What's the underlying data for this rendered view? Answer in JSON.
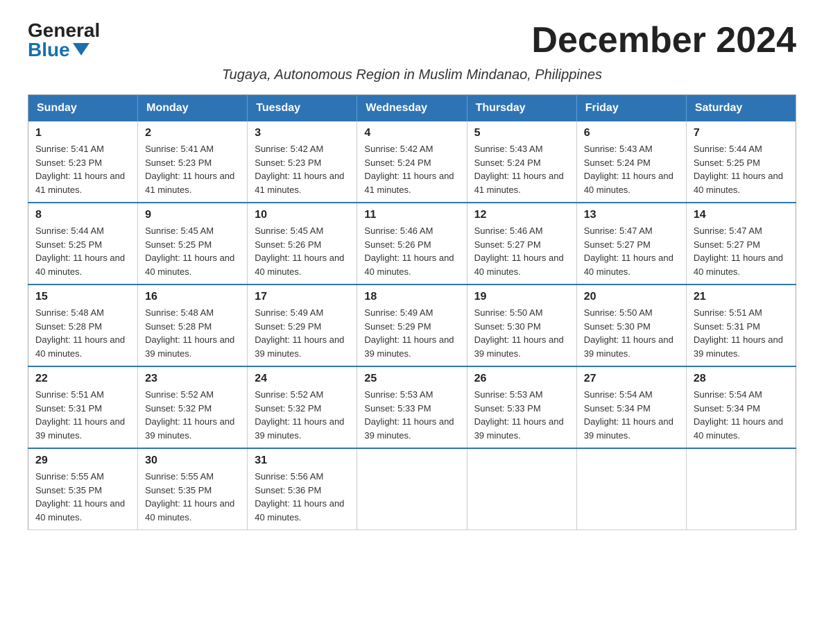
{
  "logo": {
    "general": "General",
    "blue": "Blue"
  },
  "title": "December 2024",
  "subtitle": "Tugaya, Autonomous Region in Muslim Mindanao, Philippines",
  "headers": [
    "Sunday",
    "Monday",
    "Tuesday",
    "Wednesday",
    "Thursday",
    "Friday",
    "Saturday"
  ],
  "weeks": [
    [
      {
        "day": "1",
        "sunrise": "5:41 AM",
        "sunset": "5:23 PM",
        "daylight": "11 hours and 41 minutes."
      },
      {
        "day": "2",
        "sunrise": "5:41 AM",
        "sunset": "5:23 PM",
        "daylight": "11 hours and 41 minutes."
      },
      {
        "day": "3",
        "sunrise": "5:42 AM",
        "sunset": "5:23 PM",
        "daylight": "11 hours and 41 minutes."
      },
      {
        "day": "4",
        "sunrise": "5:42 AM",
        "sunset": "5:24 PM",
        "daylight": "11 hours and 41 minutes."
      },
      {
        "day": "5",
        "sunrise": "5:43 AM",
        "sunset": "5:24 PM",
        "daylight": "11 hours and 41 minutes."
      },
      {
        "day": "6",
        "sunrise": "5:43 AM",
        "sunset": "5:24 PM",
        "daylight": "11 hours and 40 minutes."
      },
      {
        "day": "7",
        "sunrise": "5:44 AM",
        "sunset": "5:25 PM",
        "daylight": "11 hours and 40 minutes."
      }
    ],
    [
      {
        "day": "8",
        "sunrise": "5:44 AM",
        "sunset": "5:25 PM",
        "daylight": "11 hours and 40 minutes."
      },
      {
        "day": "9",
        "sunrise": "5:45 AM",
        "sunset": "5:25 PM",
        "daylight": "11 hours and 40 minutes."
      },
      {
        "day": "10",
        "sunrise": "5:45 AM",
        "sunset": "5:26 PM",
        "daylight": "11 hours and 40 minutes."
      },
      {
        "day": "11",
        "sunrise": "5:46 AM",
        "sunset": "5:26 PM",
        "daylight": "11 hours and 40 minutes."
      },
      {
        "day": "12",
        "sunrise": "5:46 AM",
        "sunset": "5:27 PM",
        "daylight": "11 hours and 40 minutes."
      },
      {
        "day": "13",
        "sunrise": "5:47 AM",
        "sunset": "5:27 PM",
        "daylight": "11 hours and 40 minutes."
      },
      {
        "day": "14",
        "sunrise": "5:47 AM",
        "sunset": "5:27 PM",
        "daylight": "11 hours and 40 minutes."
      }
    ],
    [
      {
        "day": "15",
        "sunrise": "5:48 AM",
        "sunset": "5:28 PM",
        "daylight": "11 hours and 40 minutes."
      },
      {
        "day": "16",
        "sunrise": "5:48 AM",
        "sunset": "5:28 PM",
        "daylight": "11 hours and 39 minutes."
      },
      {
        "day": "17",
        "sunrise": "5:49 AM",
        "sunset": "5:29 PM",
        "daylight": "11 hours and 39 minutes."
      },
      {
        "day": "18",
        "sunrise": "5:49 AM",
        "sunset": "5:29 PM",
        "daylight": "11 hours and 39 minutes."
      },
      {
        "day": "19",
        "sunrise": "5:50 AM",
        "sunset": "5:30 PM",
        "daylight": "11 hours and 39 minutes."
      },
      {
        "day": "20",
        "sunrise": "5:50 AM",
        "sunset": "5:30 PM",
        "daylight": "11 hours and 39 minutes."
      },
      {
        "day": "21",
        "sunrise": "5:51 AM",
        "sunset": "5:31 PM",
        "daylight": "11 hours and 39 minutes."
      }
    ],
    [
      {
        "day": "22",
        "sunrise": "5:51 AM",
        "sunset": "5:31 PM",
        "daylight": "11 hours and 39 minutes."
      },
      {
        "day": "23",
        "sunrise": "5:52 AM",
        "sunset": "5:32 PM",
        "daylight": "11 hours and 39 minutes."
      },
      {
        "day": "24",
        "sunrise": "5:52 AM",
        "sunset": "5:32 PM",
        "daylight": "11 hours and 39 minutes."
      },
      {
        "day": "25",
        "sunrise": "5:53 AM",
        "sunset": "5:33 PM",
        "daylight": "11 hours and 39 minutes."
      },
      {
        "day": "26",
        "sunrise": "5:53 AM",
        "sunset": "5:33 PM",
        "daylight": "11 hours and 39 minutes."
      },
      {
        "day": "27",
        "sunrise": "5:54 AM",
        "sunset": "5:34 PM",
        "daylight": "11 hours and 39 minutes."
      },
      {
        "day": "28",
        "sunrise": "5:54 AM",
        "sunset": "5:34 PM",
        "daylight": "11 hours and 40 minutes."
      }
    ],
    [
      {
        "day": "29",
        "sunrise": "5:55 AM",
        "sunset": "5:35 PM",
        "daylight": "11 hours and 40 minutes."
      },
      {
        "day": "30",
        "sunrise": "5:55 AM",
        "sunset": "5:35 PM",
        "daylight": "11 hours and 40 minutes."
      },
      {
        "day": "31",
        "sunrise": "5:56 AM",
        "sunset": "5:36 PM",
        "daylight": "11 hours and 40 minutes."
      },
      null,
      null,
      null,
      null
    ]
  ]
}
